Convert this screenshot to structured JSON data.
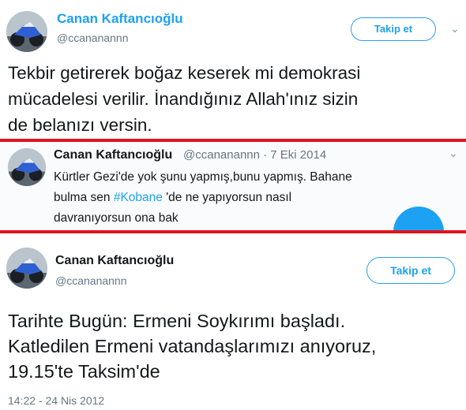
{
  "tweet1": {
    "name": "Canan Kaftancıoğlu",
    "handle": "@ccananannn",
    "follow_label": "Takip et",
    "text_lines": [
      "Tekbir getirerek boğaz keserek mi demokrasi",
      "mücadelesi verilir. İnandığınız Allah'ınız sizin",
      "de belanızı versin."
    ]
  },
  "tweet2": {
    "name": "Canan Kaftancıoğlu",
    "meta": "@ccananannn · 7 Eki 2014",
    "line1": "Kürtler Gezi'de yok şunu yapmış,bunu yapmış. Bahane",
    "line2_pre": "bulma sen ",
    "hashtag": "#Kobane",
    "line2_post": " 'de ne yapıyorsun nasıl",
    "line3": "davranıyorsun ona bak"
  },
  "tweet3": {
    "name": "Canan Kaftancıoğlu",
    "handle": "@ccananannn",
    "follow_label": "Takip et",
    "text_lines": [
      "Tarihte Bugün: Ermeni Soykırımı başladı.",
      "Katledilen Ermeni vatandaşlarımızı anıyoruz,",
      "19.15'te Taksim'de"
    ],
    "timestamp": "14:22 - 24 Nis 2012"
  },
  "colors": {
    "accent": "#1da1f2",
    "divider": "#e0141e",
    "muted": "#657786"
  },
  "icons": [
    "avatar-motorcycle",
    "chevron-down-icon"
  ]
}
